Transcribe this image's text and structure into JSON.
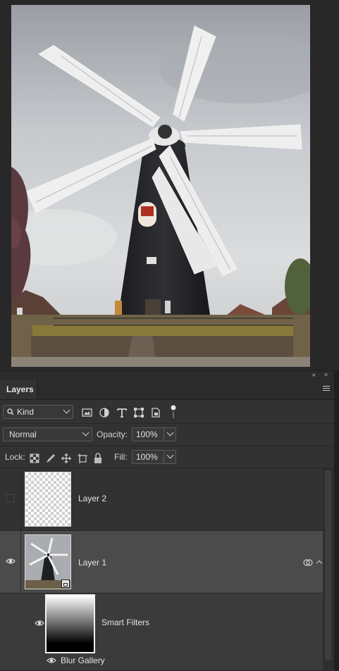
{
  "panel": {
    "tab_label": "Layers",
    "collapse_glyph": "«",
    "close_glyph": "×"
  },
  "filter_row": {
    "kind_label": "Kind",
    "filter_icons": [
      "pixel-filter-icon",
      "adjustment-filter-icon",
      "type-filter-icon",
      "shape-filter-icon",
      "smart-object-filter-icon",
      "filter-toggle-icon"
    ]
  },
  "blend_row": {
    "blend_mode": "Normal",
    "opacity_label": "Opacity:",
    "opacity_value": "100%"
  },
  "lock_row": {
    "lock_label": "Lock:",
    "lock_icons": [
      "lock-transparent-pixels-icon",
      "lock-image-pixels-icon",
      "lock-position-icon",
      "lock-artboard-icon",
      "lock-all-icon"
    ],
    "fill_label": "Fill:",
    "fill_value": "100%"
  },
  "layers": [
    {
      "name": "Layer 2",
      "visible": false,
      "selected": false,
      "thumbnail": "transparent"
    },
    {
      "name": "Layer 1",
      "visible": true,
      "selected": true,
      "thumbnail": "windmill-photo",
      "smart_object": true
    },
    {
      "name": "Smart Filters",
      "visible": true,
      "thumbnail": "filter-mask-gradient"
    }
  ],
  "smart_filter": {
    "name": "Blur Gallery",
    "visible": true
  },
  "colors": {
    "panel_bg": "#323232",
    "selected_row": "#4b4b4b",
    "canvas_bg": "#282828"
  }
}
